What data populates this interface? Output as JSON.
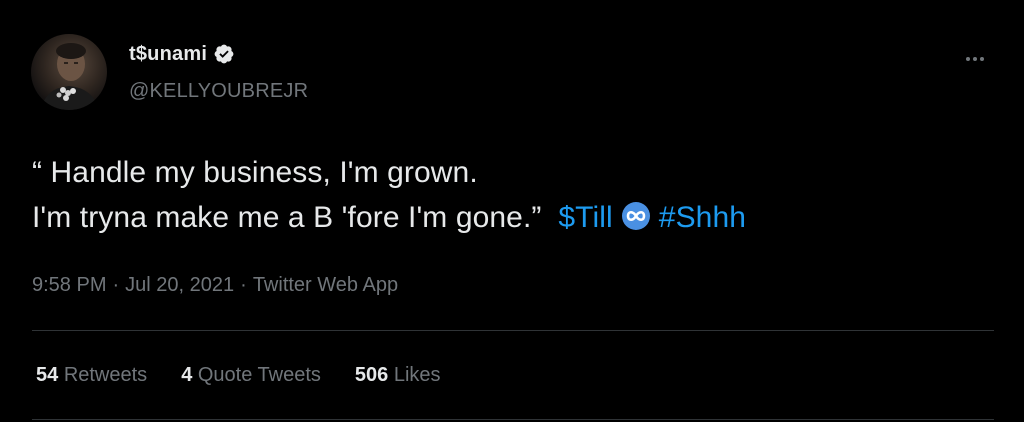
{
  "author": {
    "display_name": "t$unami",
    "handle": "@KELLYOUBREJR",
    "verified": true
  },
  "tweet": {
    "line1": "“ Handle my business, I'm grown.",
    "line2": "I'm tryna make me a B 'fore I'm gone.”",
    "cashtag": "$Till",
    "hashtag": "#Shhh",
    "emoji": "infinity-icon"
  },
  "meta": {
    "time": "9:58 PM",
    "separator": "·",
    "date": "Jul 20, 2021",
    "source": "Twitter Web App"
  },
  "stats": {
    "retweets_count": "54",
    "retweets_label": "Retweets",
    "quotes_count": "4",
    "quotes_label": "Quote Tweets",
    "likes_count": "506",
    "likes_label": "Likes"
  },
  "colors": {
    "background": "#000000",
    "text_primary": "#e7e9ea",
    "text_secondary": "#71767b",
    "link": "#1d9bf0",
    "divider": "#2f3336"
  }
}
